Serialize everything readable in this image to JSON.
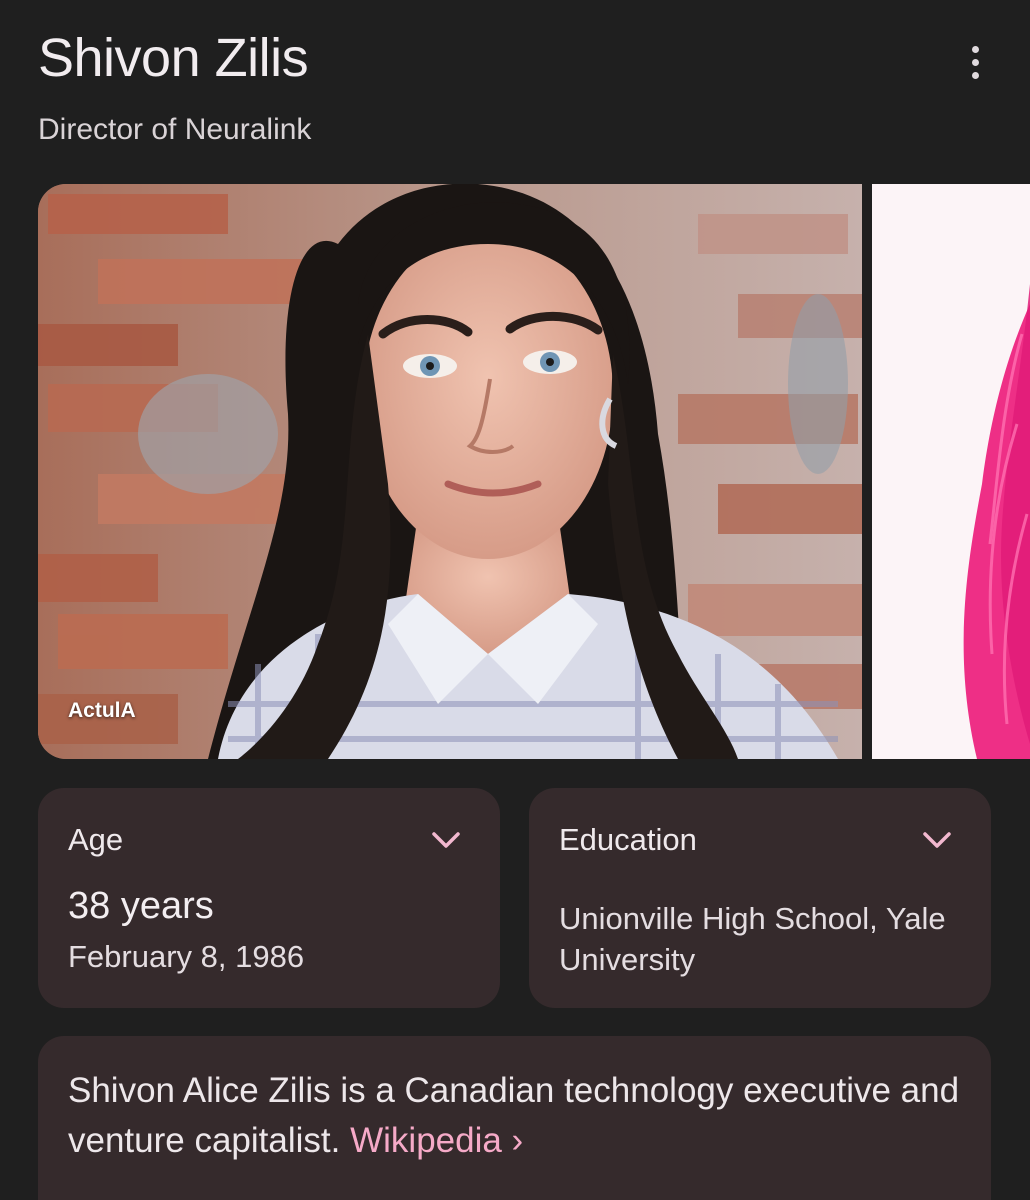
{
  "header": {
    "title": "Shivon Zilis",
    "subtitle": "Director of Neuralink",
    "menu_icon": "more-vert-icon"
  },
  "images": {
    "main_source": "ActulA"
  },
  "cards": {
    "age": {
      "label": "Age",
      "value": "38 years",
      "detail": "February 8, 1986",
      "icon": "chevron-down-icon"
    },
    "education": {
      "label": "Education",
      "value": "Unionville High School, Yale University",
      "icon": "chevron-down-icon"
    }
  },
  "description": {
    "text": "Shivon Alice Zilis is a Canadian technology executive and venture capitalist.",
    "link_label": "Wikipedia ›"
  },
  "colors": {
    "background": "#1f1f1f",
    "card": "#352a2c",
    "link": "#f6aac8",
    "chevron": "#f2b8cf"
  }
}
